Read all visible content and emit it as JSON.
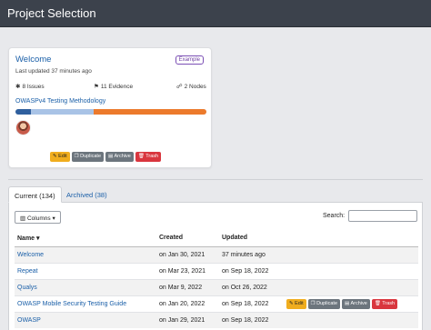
{
  "header": {
    "title": "Project Selection"
  },
  "project_card": {
    "title": "Welcome",
    "badge": "Example",
    "last_updated": "Last updated 37 minutes ago",
    "issues": "8 Issues",
    "evidence": "11 Evidence",
    "nodes": "2 Nodes",
    "methodology": "OWASPv4 Testing Methodology",
    "progress_segments": [
      {
        "fraction": 0.08,
        "color": "#2f5f9e"
      },
      {
        "fraction": 0.33,
        "color": "#a9c3e6"
      },
      {
        "fraction": 0.59,
        "color": "#ec7a2c"
      }
    ],
    "actions": {
      "edit": "Edit",
      "duplicate": "Duplicate",
      "archive": "Archive",
      "trash": "Trash"
    }
  },
  "tabs": [
    {
      "label": "Current (134)",
      "active": true
    },
    {
      "label": "Archived (38)",
      "active": false
    }
  ],
  "table_controls": {
    "columns_label": "Columns",
    "search_label": "Search:",
    "search_value": ""
  },
  "table": {
    "headers": {
      "name": "Name",
      "created": "Created",
      "updated": "Updated"
    },
    "rows": [
      {
        "name": "Welcome",
        "created": "on Jan 30, 2021",
        "updated": "37 minutes ago"
      },
      {
        "name": "Repeat",
        "created": "on Mar 23, 2021",
        "updated": "on Sep 18, 2022"
      },
      {
        "name": "Qualys",
        "created": "on Mar 9, 2022",
        "updated": "on Oct 26, 2022"
      },
      {
        "name": "OWASP Mobile Security Testing Guide",
        "created": "on Jan 20, 2022",
        "updated": "on Sep 18, 2022"
      },
      {
        "name": "OWASP",
        "created": "on Jan 29, 2021",
        "updated": "on Sep 18, 2022"
      }
    ],
    "row_actions": {
      "edit": "Edit",
      "duplicate": "Duplicate",
      "archive": "Archive",
      "trash": "Trash"
    }
  },
  "icons": {
    "issues": "bug-icon",
    "evidence": "flag-icon",
    "nodes": "sitemap-icon",
    "columns": "columns-icon",
    "caret": "caret-down-icon",
    "sort": "sort-desc-icon",
    "edit": "pencil-icon",
    "duplicate": "copy-icon",
    "archive": "archive-icon",
    "trash": "trash-icon"
  }
}
